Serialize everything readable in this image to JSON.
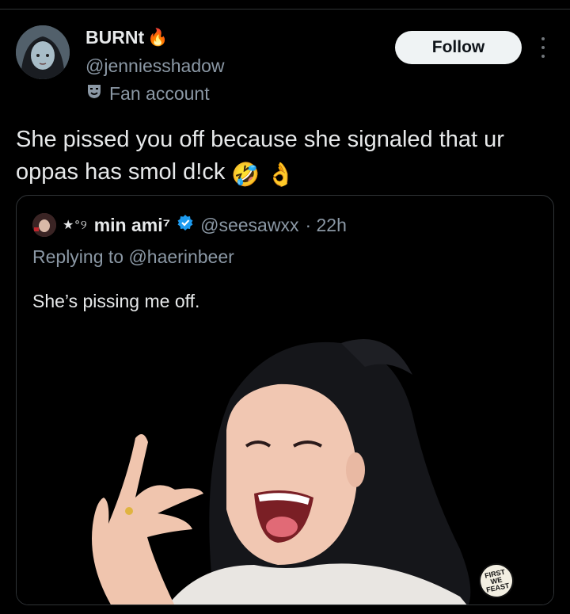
{
  "post": {
    "author": {
      "name": "BURNt",
      "name_emoji": "🔥",
      "handle": "@jenniesshadow",
      "label": "Fan account"
    },
    "follow_label": "Follow",
    "text": "She pissed you off because she signaled that ur oppas has smol d!ck",
    "text_emojis": [
      "🤣",
      "👌"
    ]
  },
  "quote": {
    "decoration": "★°୨",
    "name": "min ami⁷",
    "handle": "@seesawxx",
    "time": "· 22h",
    "replying_to": "Replying to @haerinbeer",
    "text": "She’s pissing me off.",
    "media_watermark": "FIRST WE FEAST"
  },
  "icons": {
    "verified": "verified-badge-icon",
    "more": "more-options-icon",
    "fan": "drama-masks-icon"
  },
  "colors": {
    "background": "#000000",
    "text_primary": "#e7e9ea",
    "text_secondary": "#8b98a5",
    "verified_blue": "#1d9bf0",
    "follow_bg": "#eff3f4"
  }
}
